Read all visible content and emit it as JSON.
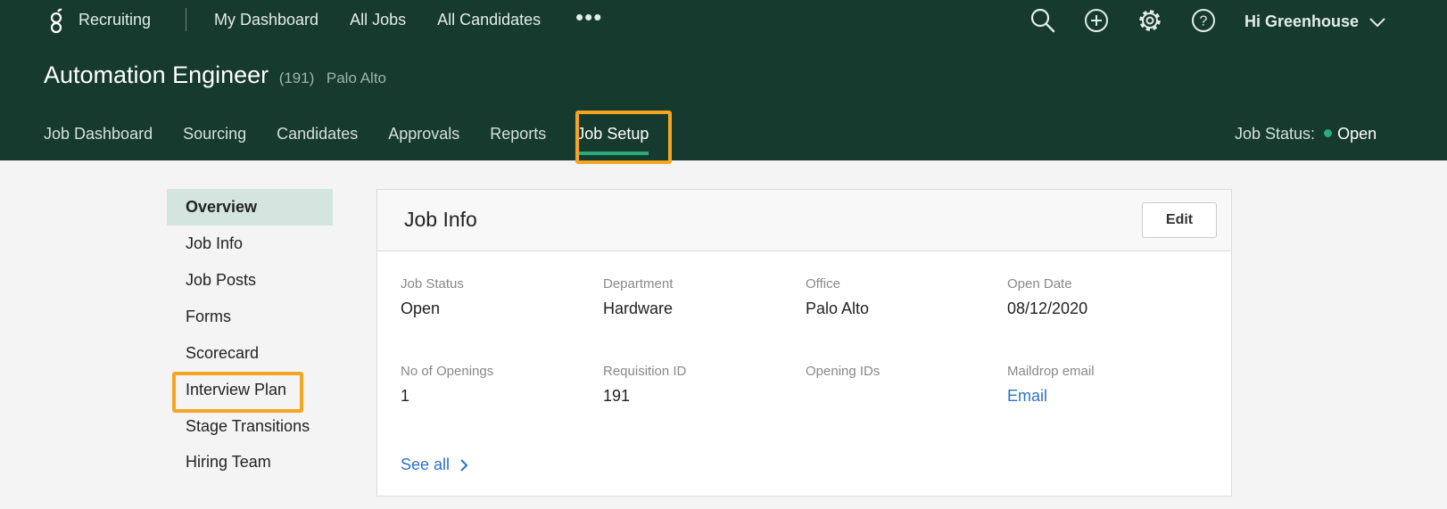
{
  "app": {
    "name": "Recruiting"
  },
  "topnav": {
    "items": [
      "My Dashboard",
      "All Jobs",
      "All Candidates"
    ],
    "more": "•••"
  },
  "user": {
    "greeting": "Hi Greenhouse"
  },
  "icons": [
    "search-icon",
    "plus-circle-icon",
    "gear-icon",
    "help-icon"
  ],
  "job": {
    "title": "Automation Engineer",
    "id": "(191)",
    "location": "Palo Alto"
  },
  "subnav": {
    "tabs": [
      "Job Dashboard",
      "Sourcing",
      "Candidates",
      "Approvals",
      "Reports",
      "Job Setup"
    ],
    "active": "Job Setup"
  },
  "job_status": {
    "label": "Job Status:",
    "value": "Open"
  },
  "sidebar": {
    "items": [
      "Overview",
      "Job Info",
      "Job Posts",
      "Forms",
      "Scorecard",
      "Interview Plan",
      "Stage Transitions",
      "Hiring Team"
    ],
    "active": "Overview"
  },
  "card": {
    "title": "Job Info",
    "edit_label": "Edit",
    "fields": [
      {
        "label": "Job Status",
        "value": "Open"
      },
      {
        "label": "Department",
        "value": "Hardware"
      },
      {
        "label": "Office",
        "value": "Palo Alto"
      },
      {
        "label": "Open Date",
        "value": "08/12/2020"
      },
      {
        "label": "No of Openings",
        "value": "1"
      },
      {
        "label": "Requisition ID",
        "value": "191"
      },
      {
        "label": "Opening IDs",
        "value": ""
      },
      {
        "label": "Maildrop email",
        "value": "Email"
      }
    ],
    "see_all": "See all"
  },
  "colors": {
    "header": "#163a2d",
    "accent": "#2dab7a",
    "highlight": "#f5a524",
    "link": "#2c73c8"
  }
}
